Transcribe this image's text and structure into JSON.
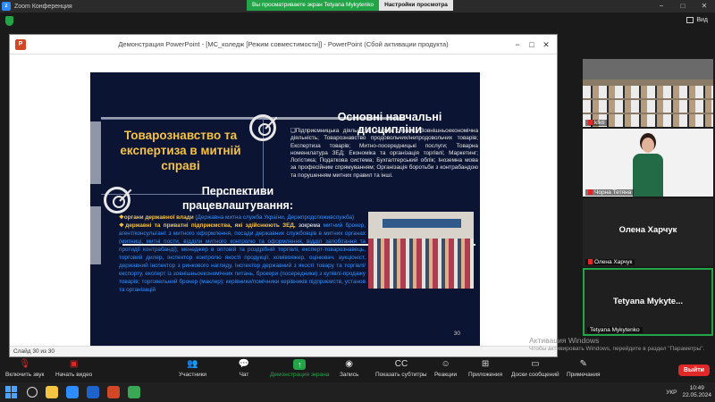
{
  "zoom": {
    "app_title": "Zoom Конференция",
    "share_message": "Вы просматриваете экран Tetyana Mykytenko",
    "view_settings": "Настройки просмотра",
    "view_label": "Вид",
    "win_min": "−",
    "win_max": "□",
    "win_close": "✕"
  },
  "powerpoint": {
    "title": "Демонстрация PowerPoint - [MC_коледж [Режим совместимости]] - PowerPoint (Сбой активации продукта)",
    "status_slide": "Слайд 30 из 30",
    "icon_letter": "P"
  },
  "slide": {
    "title_main": "Товарознавство та експертиза в митній справі",
    "title_perspectives": "Перспективи працевлаштування:",
    "subjects_heading": "Основні навчальні дисципліни",
    "subjects_text": "❑Підприємницька діяльність; Митна справа; Зовнішньоекономічна діяльність; Товарознавство продовольчих/непродовольчих товарів; Експертиза товарів; Митно-посередницькі послуги; Товарна номенклатура ЗЕД; Економіка та організація торгівлі; Маркетинг; Логістика; Податкова система; Бухгалтерський облік; Іноземна мова за професійним спрямуванням; Організація боротьби з контрабандою та порушенням митних правил та інші.",
    "opp_1_bold": "❖органи державної влади",
    "opp_1_rest": " (Державна митна служба України, Держпродспоживслужба)",
    "opp_2_bold": "❖державні та приватні підприємства, які здійснюють ЗЕД,",
    "opp_2_white": " зокрема",
    "opp_2_rest": " митний брокер, агент/консультант з митного оформлення, посади державних службовців в митних органах (митниці, митні пости, відділи митного контролю та оформлення, відділ запобігання та протидії контрабанді), менеджер в оптовій та роздрібній торгівлі, експерт-товарознавець, торговий дилер, інспектор контролю якості продукції, комівояжер, оцінювач, аукціоніст, державний інспектор з ринкового нагляду, інспектор державний з якості товару та торгівлі/експорту, експерт із зовнішньоекономічних питань, брокери (посередники) з купівлі-продажу товарів; торговельний брокер (маклер); керівники/помічники керівників підприємств, установ та організацій",
    "slide_number": "30"
  },
  "participants": [
    {
      "name": "kfkti"
    },
    {
      "name": "Чорна Тетяна"
    },
    {
      "name": "Олена Харчук",
      "display": "Олена Харчук"
    },
    {
      "name": "Tetyana Mykytenko",
      "display": "Tetyana Mykyte..."
    }
  ],
  "activation": {
    "title": "Активация Windows",
    "text": "Чтобы активировать Windows, перейдите в раздел \"Параметры\"."
  },
  "toolbar": {
    "audio": "Включить звук",
    "video": "Начать видео",
    "participants": "Участники",
    "participants_count": "4",
    "chat": "Чат",
    "share": "Демонстрация экрана",
    "record": "Запись",
    "captions": "Показать субтитры",
    "reactions": "Реакции",
    "apps": "Приложения",
    "notes": "Доски сообщений",
    "annotate": "Примечания",
    "leave": "Выйти"
  },
  "taskbar": {
    "lang": "УКР",
    "time": "10:49",
    "date": "22.05.2024"
  },
  "colors": {
    "slide_bg": "#0b1533",
    "title_yellow": "#f6c244",
    "link_blue": "#2e90ff",
    "zoom_green": "#23a448",
    "leave_red": "#e02828"
  }
}
